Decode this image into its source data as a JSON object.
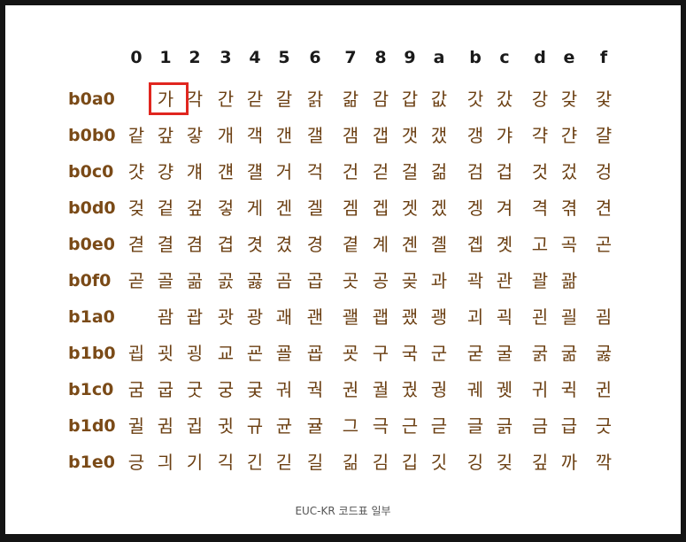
{
  "columns": [
    "0",
    "1",
    "2",
    "3",
    "4",
    "5",
    "6",
    "7",
    "8",
    "9",
    "a",
    "b",
    "c",
    "d",
    "e",
    "f"
  ],
  "highlighted_cell": {
    "row": 0,
    "col": 1
  },
  "highlight_color": "#e0261f",
  "label_color": "#7a4a17",
  "glyph_color": "#6b3f12",
  "rows": [
    {
      "label": "b0a0",
      "cells": [
        "",
        "가",
        "각",
        "간",
        "갇",
        "갈",
        "갉",
        "갊",
        "감",
        "갑",
        "값",
        "갓",
        "갔",
        "강",
        "갖",
        "갗"
      ]
    },
    {
      "label": "b0b0",
      "cells": [
        "같",
        "갚",
        "갛",
        "개",
        "객",
        "갠",
        "갤",
        "갬",
        "갭",
        "갯",
        "갰",
        "갱",
        "갸",
        "갹",
        "갼",
        "걀"
      ]
    },
    {
      "label": "b0c0",
      "cells": [
        "걋",
        "걍",
        "걔",
        "걘",
        "걜",
        "거",
        "걱",
        "건",
        "걷",
        "걸",
        "걺",
        "검",
        "겁",
        "것",
        "겄",
        "겅"
      ]
    },
    {
      "label": "b0d0",
      "cells": [
        "겆",
        "겉",
        "겊",
        "겋",
        "게",
        "겐",
        "겔",
        "겜",
        "겝",
        "겟",
        "겠",
        "겡",
        "겨",
        "격",
        "겪",
        "견"
      ]
    },
    {
      "label": "b0e0",
      "cells": [
        "겯",
        "결",
        "겸",
        "겹",
        "겻",
        "겼",
        "경",
        "곁",
        "계",
        "곈",
        "곌",
        "곕",
        "곗",
        "고",
        "곡",
        "곤"
      ]
    },
    {
      "label": "b0f0",
      "cells": [
        "곧",
        "골",
        "곪",
        "곬",
        "곯",
        "곰",
        "곱",
        "곳",
        "공",
        "곶",
        "과",
        "곽",
        "관",
        "괄",
        "괆",
        ""
      ]
    },
    {
      "label": "b1a0",
      "cells": [
        "",
        "괌",
        "괍",
        "괏",
        "광",
        "괘",
        "괜",
        "괠",
        "괩",
        "괬",
        "괭",
        "괴",
        "괵",
        "괸",
        "괼",
        "굄"
      ]
    },
    {
      "label": "b1b0",
      "cells": [
        "굅",
        "굇",
        "굉",
        "교",
        "굔",
        "굘",
        "굡",
        "굣",
        "구",
        "국",
        "군",
        "굳",
        "굴",
        "굵",
        "굶",
        "굻"
      ]
    },
    {
      "label": "b1c0",
      "cells": [
        "굼",
        "굽",
        "굿",
        "궁",
        "궂",
        "궈",
        "궉",
        "권",
        "궐",
        "궜",
        "궝",
        "궤",
        "궷",
        "귀",
        "귁",
        "귄"
      ]
    },
    {
      "label": "b1d0",
      "cells": [
        "귈",
        "귐",
        "귑",
        "귓",
        "규",
        "균",
        "귤",
        "그",
        "극",
        "근",
        "귿",
        "글",
        "긁",
        "금",
        "급",
        "긋"
      ]
    },
    {
      "label": "b1e0",
      "cells": [
        "긍",
        "긔",
        "기",
        "긱",
        "긴",
        "긷",
        "길",
        "긺",
        "김",
        "깁",
        "깃",
        "깅",
        "깆",
        "깊",
        "까",
        "깍"
      ]
    }
  ],
  "caption": "EUC-KR 코드표 일부"
}
